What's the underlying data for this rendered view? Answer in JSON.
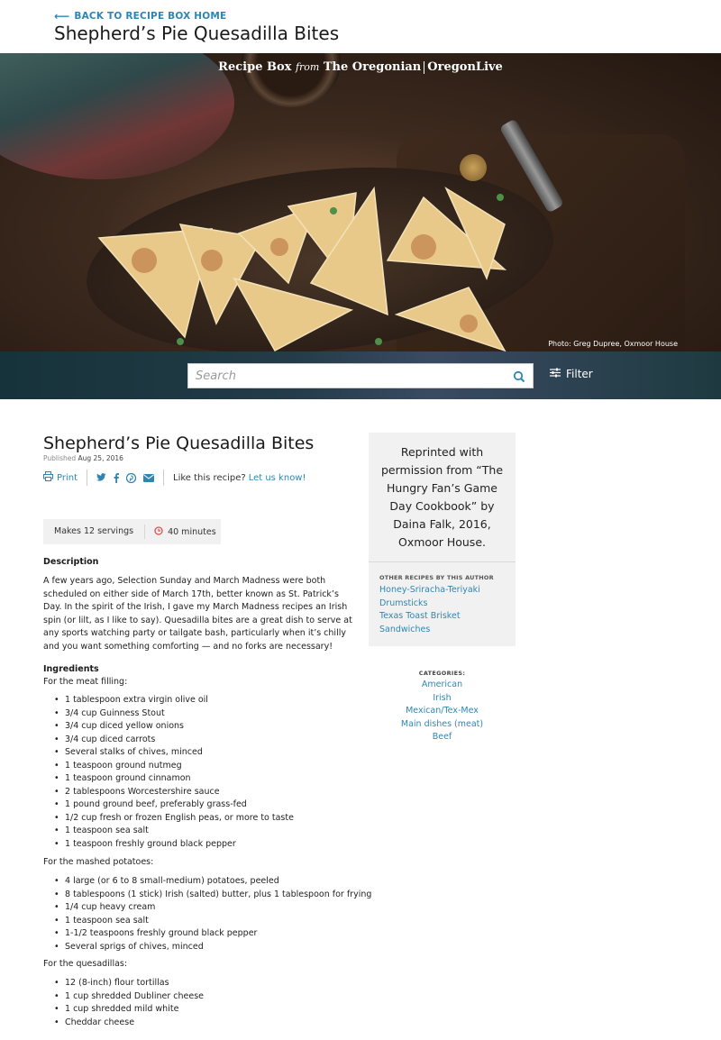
{
  "header": {
    "back_link": "BACK TO RECIPE BOX HOME",
    "title": "Shepherd’s Pie Quesadilla Bites"
  },
  "hero": {
    "brand_primary": "Recipe Box",
    "brand_from": "from",
    "brand_paper": "The Oregonian",
    "brand_site": "OregonLive",
    "photo_credit": "Photo: Greg Dupree, Oxmoor House"
  },
  "search": {
    "placeholder": "Search",
    "filter_label": "Filter"
  },
  "recipe": {
    "title": "Shepherd’s Pie Quesadilla Bites",
    "published_label": "Published",
    "published_date": "Aug 25, 2016",
    "print_label": "Print",
    "like_text": "Like this recipe?",
    "like_link": "Let us know!",
    "servings": "Makes 12 servings",
    "time": "40 minutes",
    "description_heading": "Description",
    "description": "A few years ago, Selection Sunday and March Madness were both scheduled on either side of March 17th, better known as St. Patrick’s Day. In the spirit of the Irish, I gave my March Madness recipes an Irish spin (or lilt, as I like to say). Quesadilla bites are a great dish to serve at any sports watching party or tailgate bash, particularly when it’s chilly and you want something comforting — and no forks are necessary!",
    "ingredients_heading": "Ingredients",
    "groups": [
      {
        "label": "For the meat filling:",
        "items": [
          "1 tablespoon extra virgin olive oil",
          "3/4 cup Guinness Stout",
          "3/4 cup diced yellow onions",
          "3/4 cup diced carrots",
          "Several stalks of chives, minced",
          "1 teaspoon ground nutmeg",
          "1 teaspoon ground cinnamon",
          "2 tablespoons Worcestershire sauce",
          "1 pound ground beef, preferably grass-fed",
          "1/2 cup fresh or frozen English peas, or more to taste",
          "1 teaspoon sea salt",
          "1 teaspoon freshly ground black pepper"
        ]
      },
      {
        "label": "For the mashed potatoes:",
        "items": [
          "4 large (or 6 to 8 small-medium) potatoes, peeled",
          "8 tablespoons (1 stick) Irish (salted) butter, plus 1 tablespoon for frying",
          "1/4 cup heavy cream",
          "1 teaspoon sea salt",
          "1-1/2 teaspoons freshly ground black pepper",
          "Several sprigs of chives, minced"
        ]
      },
      {
        "label": "For the quesadillas:",
        "items": [
          "12 (8-inch) flour tortillas",
          "1 cup shredded Dubliner cheese",
          "1 cup shredded mild white",
          "Cheddar cheese"
        ]
      }
    ]
  },
  "sidebar": {
    "reprint": "Reprinted with permission from “The Hungry Fan’s Game Day Cookbook” by Daina Falk, 2016, Oxmoor House.",
    "other_heading": "OTHER RECIPES BY THIS AUTHOR",
    "other_recipes": [
      "Honey-Sriracha-Teriyaki Drumsticks",
      "Texas Toast Brisket Sandwiches"
    ],
    "categories_heading": "CATEGORIES:",
    "categories": [
      "American",
      "Irish",
      "Mexican/Tex-Mex",
      "Main dishes (meat)",
      "Beef"
    ]
  },
  "colors": {
    "link": "#2f86b3",
    "clock_icon": "#d9534f"
  }
}
